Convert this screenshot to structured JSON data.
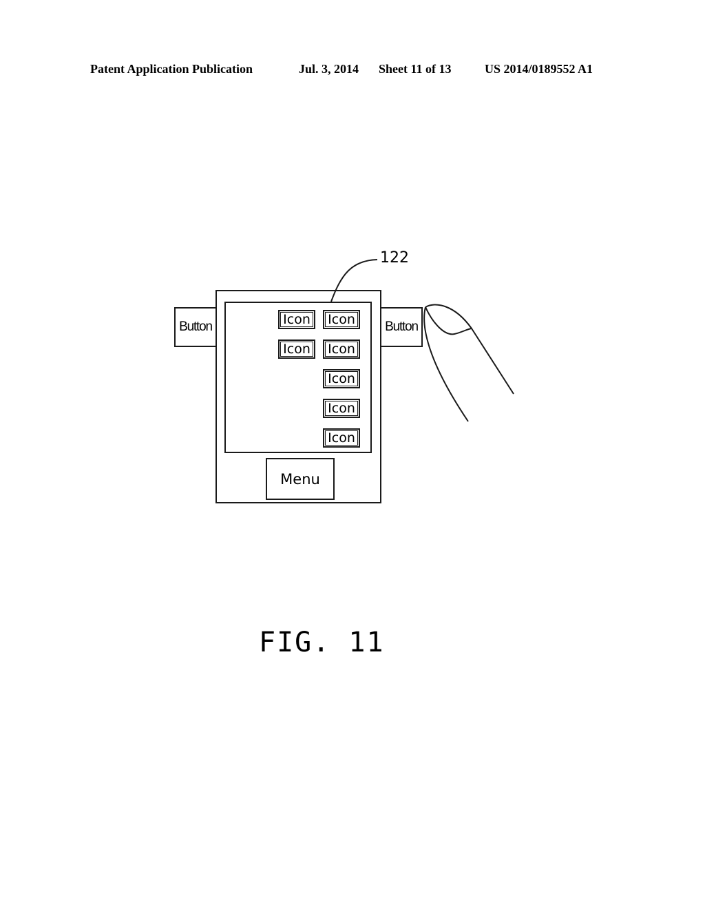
{
  "header": {
    "publication": "Patent Application Publication",
    "date": "Jul. 3, 2014",
    "sheet": "Sheet 11 of 13",
    "number": "US 2014/0189552 A1"
  },
  "figure": {
    "caption": "FIG. 11",
    "reference_label": "122",
    "device": {
      "left_button": "Button",
      "right_button": "Button",
      "menu_button": "Menu",
      "icons": [
        "Icon",
        "Icon",
        "Icon",
        "Icon",
        "Icon",
        "Icon",
        "Icon"
      ]
    },
    "finger_icon": "finger-touch"
  }
}
